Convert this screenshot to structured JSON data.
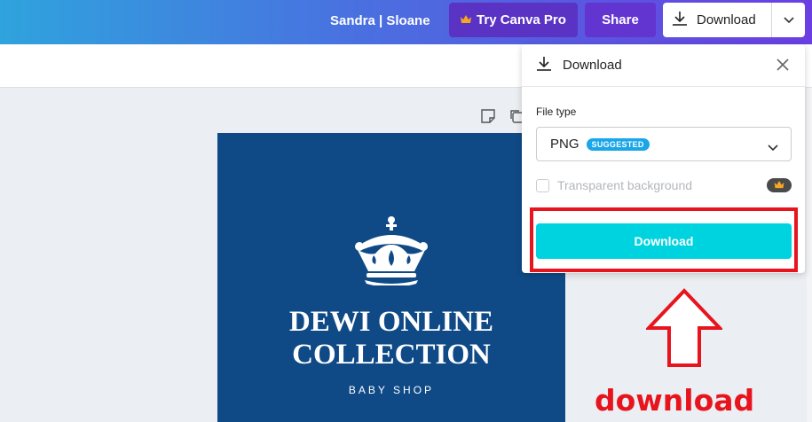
{
  "topbar": {
    "user_label": "Sandra | Sloane",
    "try_pro_label": "Try Canva Pro",
    "share_label": "Share",
    "download_label": "Download"
  },
  "design": {
    "title_line1": "DEWI ONLINE",
    "title_line2": "COLLECTION",
    "subtitle": "BABY SHOP",
    "background_color": "#0f4a86"
  },
  "download_panel": {
    "title": "Download",
    "file_type_label": "File type",
    "file_type_value": "PNG",
    "file_type_badge": "SUGGESTED",
    "transparent_background_label": "Transparent background",
    "download_button_label": "Download"
  },
  "annotation": {
    "text": "download",
    "color": "#e8141d"
  },
  "icons": [
    "crown-icon",
    "download-icon",
    "chevron-down-icon",
    "close-icon",
    "sticky-note-icon",
    "copy-icon",
    "up-arrow-icon"
  ]
}
